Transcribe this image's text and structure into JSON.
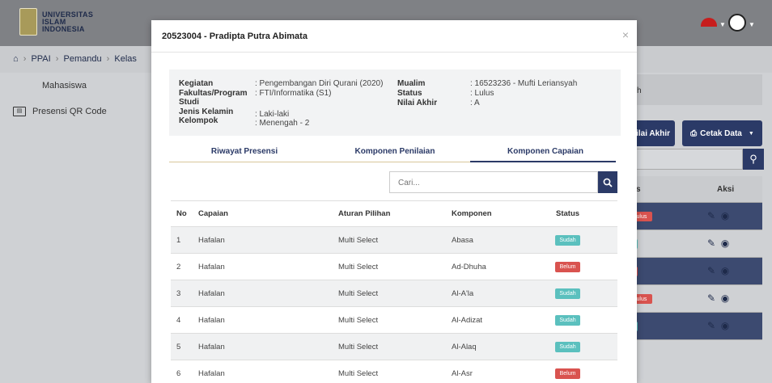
{
  "header": {
    "logo_lines": [
      "UNIVERSITAS",
      "ISLAM",
      "INDONESIA"
    ]
  },
  "breadcrumb": [
    "PPAI",
    "Pemandu",
    "Kelas"
  ],
  "sidebar": {
    "items": [
      {
        "label": "Mahasiswa",
        "icon": "none"
      },
      {
        "label": "Presensi QR Code",
        "icon": "id-card-icon"
      }
    ]
  },
  "background": {
    "header_partial": "h",
    "btn_nilai": "ilai Akhir",
    "btn_cetak": "Cetak Data",
    "col_partial": "s",
    "col_aksi": "Aksi",
    "rows": [
      {
        "status": "Lulus",
        "color": "#d9534f"
      },
      {
        "status": "",
        "color": "#5bc0be"
      },
      {
        "status": "",
        "color": "#d9534f"
      },
      {
        "status": "Lulus",
        "color": "#d9534f"
      },
      {
        "status": "",
        "color": "#5bc0be"
      }
    ]
  },
  "modal": {
    "title": "20523004 - Pradipta Putra Abimata",
    "close": "×",
    "info": {
      "kegiatan_label": "Kegiatan",
      "kegiatan_value": ": Pengembangan Diri Qurani (2020)",
      "fakultas_label": "Fakultas/Program",
      "fakultas_label2": "Studi",
      "fakultas_value": ": FTI/Informatika (S1)",
      "jk_label": "Jenis Kelamin",
      "jk_value": ": Laki-laki",
      "kelompok_label": "Kelompok",
      "kelompok_value": ": Menengah - 2",
      "mualim_label": "Mualim",
      "mualim_value": ": 16523236 - Mufti Leriansyah",
      "status_label": "Status",
      "status_value": ": Lulus",
      "nilai_label": "Nilai Akhir",
      "nilai_value": ": A"
    },
    "tabs": [
      {
        "label": "Riwayat Presensi",
        "active": false
      },
      {
        "label": "Komponen Penilaian",
        "active": false
      },
      {
        "label": "Komponen Capaian",
        "active": true
      }
    ],
    "search_placeholder": "Cari...",
    "table": {
      "headers": [
        "No",
        "Capaian",
        "Aturan Pilihan",
        "Komponen",
        "Status"
      ],
      "rows": [
        {
          "no": "1",
          "capaian": "Hafalan",
          "aturan": "Multi Select",
          "komponen": "Abasa",
          "status": "Sudah",
          "color": "#5bc0be"
        },
        {
          "no": "2",
          "capaian": "Hafalan",
          "aturan": "Multi Select",
          "komponen": "Ad-Dhuha",
          "status": "Belum",
          "color": "#d9534f"
        },
        {
          "no": "3",
          "capaian": "Hafalan",
          "aturan": "Multi Select",
          "komponen": "Al-A'la",
          "status": "Sudah",
          "color": "#5bc0be"
        },
        {
          "no": "4",
          "capaian": "Hafalan",
          "aturan": "Multi Select",
          "komponen": "Al-Adizat",
          "status": "Sudah",
          "color": "#5bc0be"
        },
        {
          "no": "5",
          "capaian": "Hafalan",
          "aturan": "Multi Select",
          "komponen": "Al-Alaq",
          "status": "Sudah",
          "color": "#5bc0be"
        },
        {
          "no": "6",
          "capaian": "Hafalan",
          "aturan": "Multi Select",
          "komponen": "Al-Asr",
          "status": "Belum",
          "color": "#d9534f"
        }
      ]
    }
  }
}
